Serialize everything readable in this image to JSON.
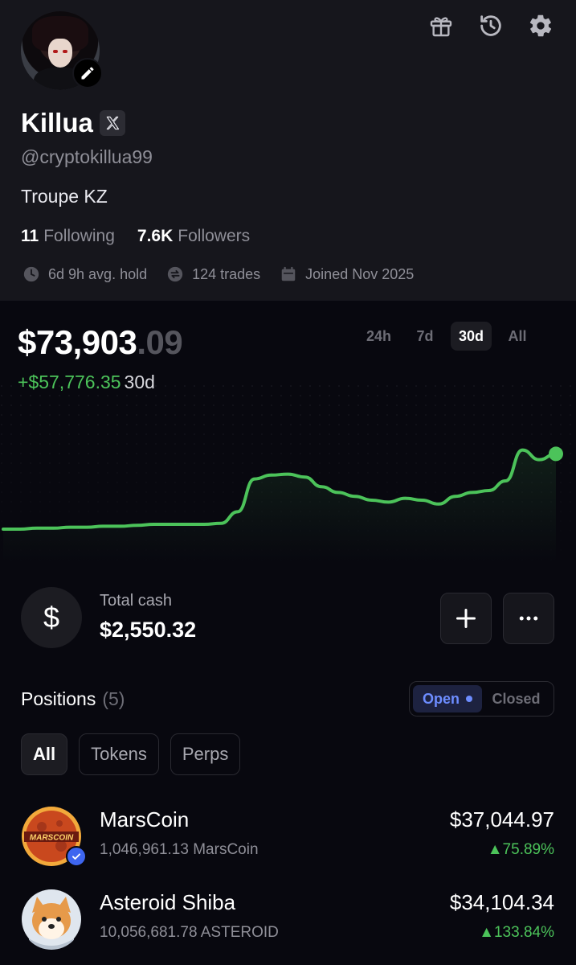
{
  "profile": {
    "name": "Killua",
    "handle": "@cryptokillua99",
    "bio": "Troupe KZ",
    "following_count": "11",
    "following_label": "Following",
    "followers_count": "7.6K",
    "followers_label": "Followers",
    "avg_hold": "6d 9h avg. hold",
    "trades": "124 trades",
    "joined": "Joined Nov 2025"
  },
  "header_icons": [
    "gift-icon",
    "history-icon",
    "settings-icon"
  ],
  "portfolio": {
    "balance_main": "$73,903",
    "balance_cents": ".09",
    "change": "+$57,776.35",
    "change_period": "30d",
    "ranges": [
      "24h",
      "7d",
      "30d",
      "All"
    ],
    "active_range": "30d"
  },
  "chart_data": {
    "type": "line",
    "title": "",
    "series": [
      {
        "values": [
          0.0,
          0.0,
          0.01,
          0.01,
          0.02,
          0.02,
          0.03,
          0.03,
          0.04,
          0.05,
          0.05,
          0.05,
          0.05,
          0.06,
          0.18,
          0.52,
          0.56,
          0.57,
          0.54,
          0.44,
          0.38,
          0.34,
          0.3,
          0.28,
          0.32,
          0.3,
          0.26,
          0.34,
          0.38,
          0.4,
          0.5,
          0.82,
          0.72,
          0.78
        ]
      }
    ],
    "color": "#4cc35a",
    "axes_visible": false,
    "grid": "dotted background"
  },
  "cash": {
    "label": "Total cash",
    "value": "$2,550.32",
    "icon_glyph": "$"
  },
  "positions": {
    "title": "Positions",
    "count": "(5)",
    "toggle_open": "Open",
    "toggle_closed": "Closed",
    "filters": [
      "All",
      "Tokens",
      "Perps"
    ],
    "active_filter": "All",
    "items": [
      {
        "name": "MarsCoin",
        "quantity": "1,046,961.13 MarsCoin",
        "value": "$37,044.97",
        "change": "▲75.89%",
        "logo_text": "MARSCOIN",
        "verified": true
      },
      {
        "name": "Asteroid Shiba",
        "quantity": "10,056,681.78 ASTEROID",
        "value": "$34,104.34",
        "change": "▲133.84%",
        "verified": false
      }
    ]
  },
  "colors": {
    "background": "#08080f",
    "header_background": "#16161c",
    "positive": "#4cc35a",
    "accent_blue": "#6d8dff"
  }
}
